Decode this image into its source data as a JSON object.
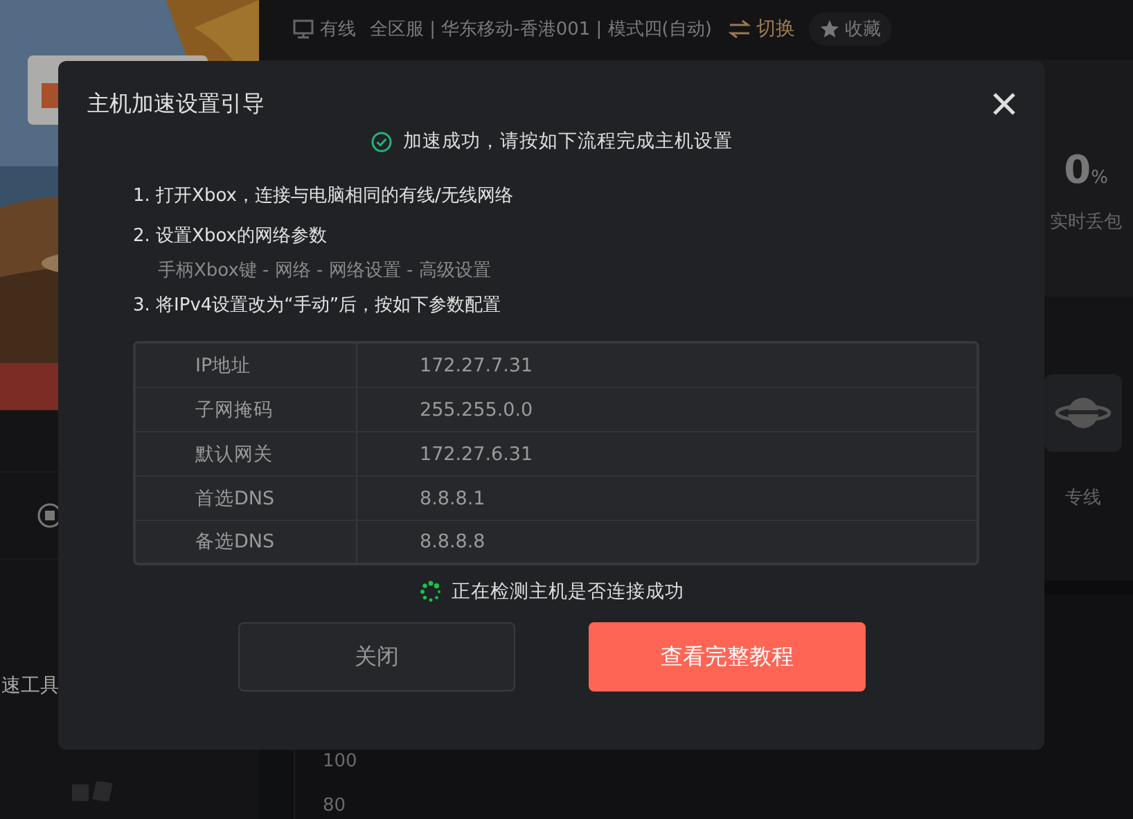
{
  "background": {
    "top_bar": {
      "connection": "有线",
      "route": "全区服 | 华东移动-香港001 | 模式四(自动)",
      "switch_label": "切换",
      "favorite_label": "收藏"
    },
    "packet_loss": {
      "value": "0",
      "unit": "%",
      "label": "实时丢包"
    },
    "line_tile": {
      "label": "专线"
    },
    "sidebar_text": "速工具",
    "chart_axis_labels": [
      "100",
      "80"
    ]
  },
  "dialog": {
    "title": "主机加速设置引导",
    "status": "加速成功，请按如下流程完成主机设置",
    "steps": [
      {
        "kind": "step",
        "text": "1. 打开Xbox，连接与电脑相同的有线/无线网络"
      },
      {
        "kind": "step",
        "text": "2. 设置Xbox的网络参数"
      },
      {
        "kind": "hint",
        "text": "手柄Xbox键 - 网络 -  网络设置 - 高级设置"
      },
      {
        "kind": "step",
        "text": "3. 将IPv4设置改为“手动”后，按如下参数配置"
      }
    ],
    "settings": [
      {
        "label": "IP地址",
        "value": "172.27.7.31"
      },
      {
        "label": "子网掩码",
        "value": "255.255.0.0"
      },
      {
        "label": "默认网关",
        "value": "172.27.6.31"
      },
      {
        "label": "首选DNS",
        "value": "8.8.8.1"
      },
      {
        "label": "备选DNS",
        "value": "8.8.8.8"
      }
    ],
    "detecting": "正在检测主机是否连接成功",
    "buttons": [
      {
        "kind": "secondary",
        "label": "关闭"
      },
      {
        "kind": "primary",
        "label": "查看完整教程"
      }
    ]
  }
}
